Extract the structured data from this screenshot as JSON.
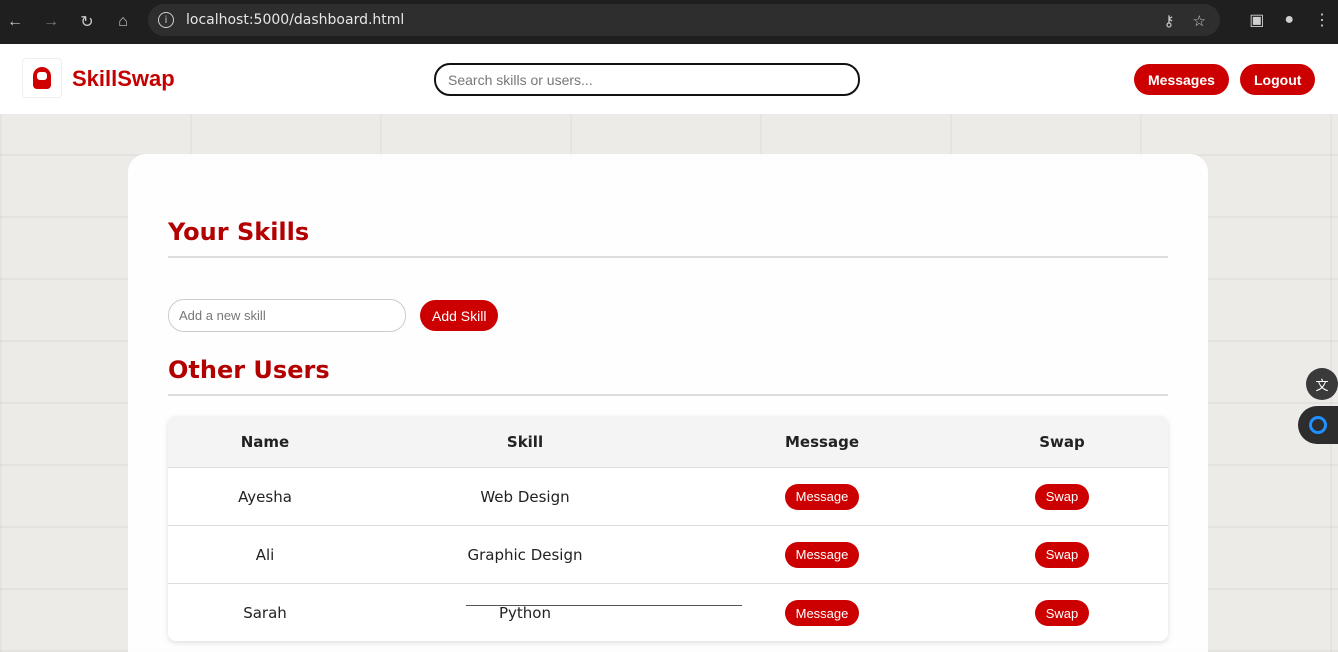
{
  "browser": {
    "url": "localhost:5000/dashboard.html"
  },
  "header": {
    "brand": "SkillSwap",
    "search_placeholder": "Search skills or users...",
    "messages_label": "Messages",
    "logout_label": "Logout"
  },
  "skills": {
    "title": "Your Skills",
    "input_placeholder": "Add a new skill",
    "add_label": "Add Skill"
  },
  "users": {
    "title": "Other Users",
    "columns": [
      "Name",
      "Skill",
      "Message",
      "Swap"
    ],
    "rows": [
      {
        "name": "Ayesha",
        "skill": "Web Design",
        "message": "Message",
        "swap": "Swap"
      },
      {
        "name": "Ali",
        "skill": "Graphic Design",
        "message": "Message",
        "swap": "Swap"
      },
      {
        "name": "Sarah",
        "skill": "Python",
        "message": "Message",
        "swap": "Swap"
      }
    ]
  },
  "colors": {
    "accent": "#cc0000",
    "title": "#b30000"
  }
}
